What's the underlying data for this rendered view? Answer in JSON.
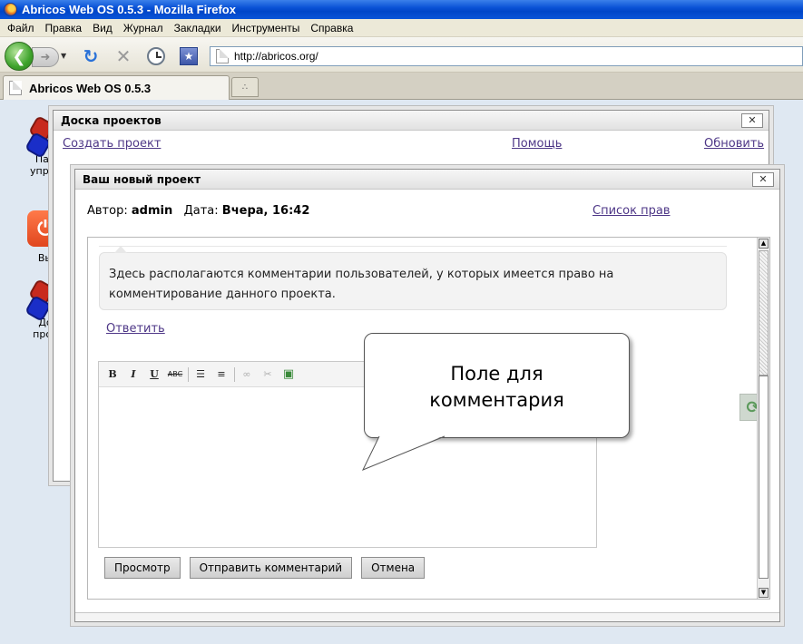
{
  "browser": {
    "window_title": "Abricos Web OS 0.5.3 - Mozilla Firefox",
    "menu": [
      "Файл",
      "Правка",
      "Вид",
      "Журнал",
      "Закладки",
      "Инструменты",
      "Справка"
    ],
    "url": "http://abricos.org/",
    "tab_title": "Abricos Web OS 0.5.3"
  },
  "desktop": {
    "icons": [
      {
        "label": "Пан\nуправ",
        "icon": "control-panel-icon"
      },
      {
        "label": "Вы",
        "icon": "exit-icon"
      },
      {
        "label": "До\nпрое",
        "icon": "projects-board-icon"
      }
    ]
  },
  "board_window": {
    "title": "Доска проектов",
    "close": "✕",
    "create_link": "Создать проект",
    "help_link": "Помощь",
    "refresh_link": "Обновить"
  },
  "project_window": {
    "title": "Ваш новый проект",
    "close": "✕",
    "author_label": "Автор:",
    "author": "admin",
    "date_label": "Дата:",
    "date": "Вчера, 16:42",
    "rights_link": "Список прав",
    "comment_text": "Здесь располагаются комментарии пользователей, у которых имеется право на комментирование данного проекта.",
    "reply_link": "Ответить",
    "editor_toolbar": [
      "B",
      "I",
      "U",
      "ABC"
    ],
    "buttons": {
      "preview": "Просмотр",
      "send": "Отправить комментарий",
      "cancel": "Отмена"
    }
  },
  "callout": {
    "line1": "Поле для",
    "line2": "комментария"
  }
}
